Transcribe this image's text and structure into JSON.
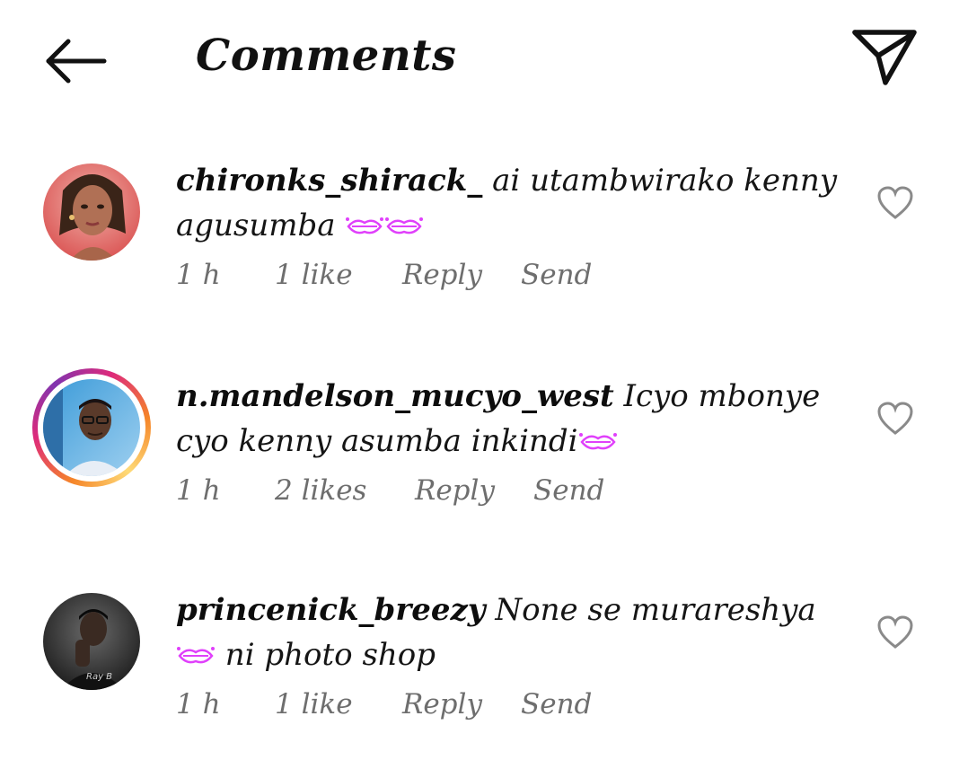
{
  "header": {
    "title": "Comments",
    "back_icon": "arrow-left-icon",
    "share_icon": "paper-plane-icon"
  },
  "colors": {
    "text": "#111111",
    "meta": "#6e6e6e",
    "emoji": "#e040fb",
    "story_ring": [
      "#f58529",
      "#dd2a7b",
      "#8134af",
      "#feda77"
    ]
  },
  "comments": [
    {
      "username": "chironks_shirack_",
      "text_line1": " ai utambwirako kenny",
      "text_line2": "agusumba",
      "emojis_after": "kiss-lips-emoji x2",
      "time": "1 h",
      "likes": "1 like",
      "reply": "Reply",
      "send": "Send",
      "has_story": false
    },
    {
      "username": "n.mandelson_mucyo_west",
      "text_line1": " Icyo mbonye",
      "text_line2": "cyo kenny asumba inkindi",
      "emojis_after": "kiss-lips-emoji x1",
      "time": "1 h",
      "likes": "2 likes",
      "reply": "Reply",
      "send": "Send",
      "has_story": true
    },
    {
      "username": "princenick_breezy",
      "text_line1": " None se murareshya",
      "text_line2": " ni photo shop",
      "emojis_before_line2": "kiss-lips-emoji x1",
      "time": "1 h",
      "likes": "1 like",
      "reply": "Reply",
      "send": "Send",
      "has_story": false
    }
  ]
}
